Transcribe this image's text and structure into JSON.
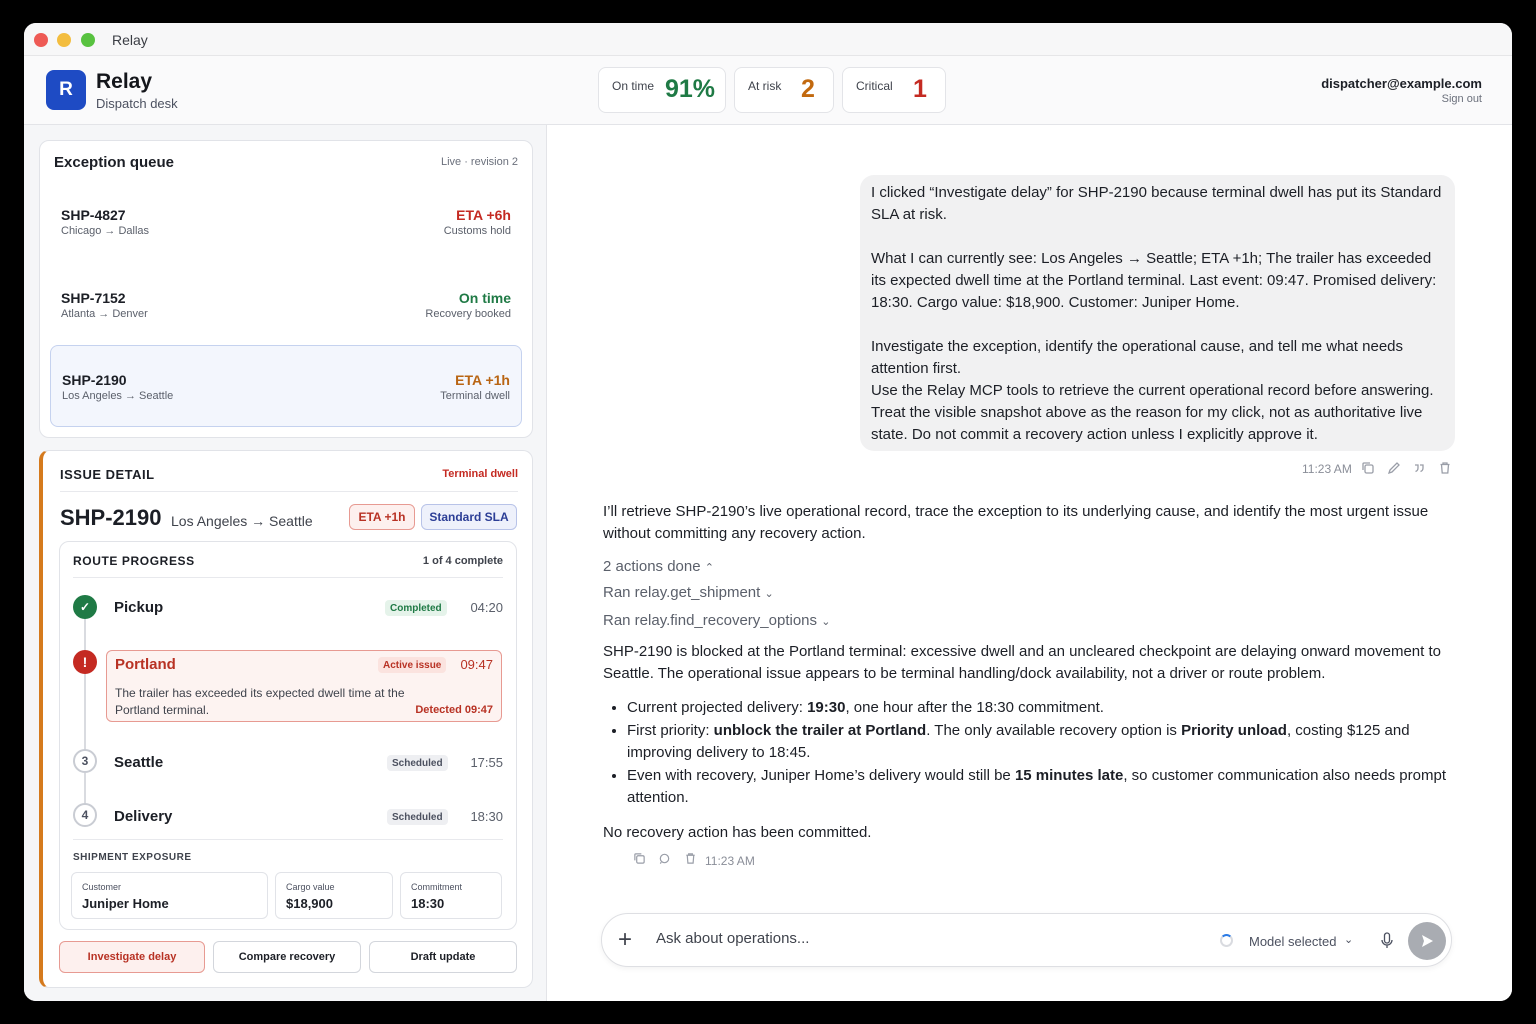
{
  "window": {
    "title": "Relay"
  },
  "header": {
    "logo_letter": "R",
    "app_name": "Relay",
    "app_subtitle": "Dispatch desk",
    "stats": [
      {
        "label": "On time",
        "value": "91%",
        "color": "#1f7a45"
      },
      {
        "label": "At risk",
        "value": "2",
        "color": "#c2690f"
      },
      {
        "label": "Critical",
        "value": "1",
        "color": "#c42a22"
      }
    ],
    "user_email": "dispatcher@example.com",
    "sign_out": "Sign out"
  },
  "queue": {
    "title": "Exception queue",
    "meta": "Live · revision 2",
    "items": [
      {
        "id": "SHP-4827",
        "route": "Chicago → Dallas",
        "status": "ETA +6h",
        "substatus": "Customs hold"
      },
      {
        "id": "SHP-7152",
        "route": "Atlanta → Denver",
        "status": "On time",
        "substatus": "Recovery booked"
      },
      {
        "id": "SHP-2190",
        "route": "Los Angeles → Seattle",
        "status": "ETA +1h",
        "substatus": "Terminal dwell"
      }
    ]
  },
  "detail": {
    "heading": "ISSUE DETAIL",
    "tag": "Terminal dwell",
    "shipment_id": "SHP-2190",
    "route": "Los Angeles → Seattle",
    "eta_pill": "ETA +1h",
    "sla_pill": "Standard SLA",
    "progress": {
      "title": "ROUTE PROGRESS",
      "count": "1 of 4 complete",
      "steps": [
        {
          "marker": "✓",
          "name": "Pickup",
          "badge": "Completed",
          "time": "04:20"
        },
        {
          "marker": "!",
          "name": "Portland",
          "badge": "Active issue",
          "time": "09:47",
          "note": "The trailer has exceeded its expected dwell time at the Portland terminal.",
          "detected": "Detected 09:47"
        },
        {
          "marker": "3",
          "name": "Seattle",
          "badge": "Scheduled",
          "time": "17:55"
        },
        {
          "marker": "4",
          "name": "Delivery",
          "badge": "Scheduled",
          "time": "18:30"
        }
      ]
    },
    "exposure": {
      "title": "SHIPMENT EXPOSURE",
      "cards": [
        {
          "label": "Customer",
          "value": "Juniper Home"
        },
        {
          "label": "Cargo value",
          "value": "$18,900"
        },
        {
          "label": "Commitment",
          "value": "18:30"
        }
      ]
    },
    "actions": [
      "Investigate delay",
      "Compare recovery",
      "Draft update"
    ]
  },
  "chat": {
    "user_message": {
      "p1": "I clicked “Investigate delay” for SHP-2190 because terminal dwell has put its Standard SLA at risk.",
      "p2": "What I can currently see: Los Angeles → Seattle; ETA +1h; The trailer has exceeded its expected dwell time at the Portland terminal. Last event: 09:47. Promised delivery: 18:30. Cargo value: $18,900. Customer: Juniper Home.",
      "p3": "Investigate the exception, identify the operational cause, and tell me what needs attention first.",
      "p4": "Use the Relay MCP tools to retrieve the current operational record before answering. Treat the visible snapshot above as the reason for my click, not as authoritative live state. Do not commit a recovery action unless I explicitly approve it.",
      "time": "11:23 AM"
    },
    "assistant": {
      "intro": "I’ll retrieve SHP-2190’s live operational record, trace the exception to its underlying cause, and identify the most urgent issue without committing any recovery action.",
      "actions_done": "2 actions done",
      "tool1": "Ran relay.get_shipment",
      "tool2": "Ran relay.find_recovery_options",
      "summary": "SHP-2190 is blocked at the Portland terminal: excessive dwell and an uncleared checkpoint are delaying onward movement to Seattle. The operational issue appears to be terminal handling/dock availability, not a driver or route problem.",
      "b1_pre": "Current projected delivery: ",
      "b1_bold": "19:30",
      "b1_post": ", one hour after the 18:30 commitment.",
      "b2_pre": "First priority: ",
      "b2_bold1": "unblock the trailer at Portland",
      "b2_mid": ". The only available recovery option is ",
      "b2_bold2": "Priority unload",
      "b2_post": ", costing $125 and improving delivery to 18:45.",
      "b3_pre": "Even with recovery, Juniper Home’s delivery would still be ",
      "b3_bold": "15 minutes late",
      "b3_post": ", so customer communication also needs prompt attention.",
      "closing": "No recovery action has been committed.",
      "time": "11:23 AM"
    },
    "composer": {
      "placeholder": "Ask about operations...",
      "model": "Model selected"
    }
  }
}
